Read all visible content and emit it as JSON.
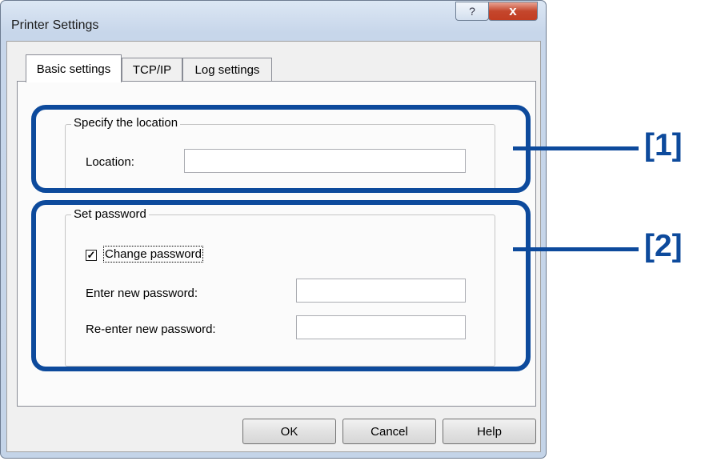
{
  "window": {
    "title": "Printer Settings",
    "help_glyph": "?",
    "close_glyph": "x"
  },
  "tabs": [
    {
      "label": "Basic settings",
      "active": true
    },
    {
      "label": "TCP/IP",
      "active": false
    },
    {
      "label": "Log settings",
      "active": false
    }
  ],
  "location_group": {
    "title": "Specify the location",
    "label": "Location:",
    "value": ""
  },
  "password_group": {
    "title": "Set password",
    "change_checkbox_label": "Change password",
    "change_checked": true,
    "check_glyph": "✓",
    "new_label": "Enter new password:",
    "new_value": "",
    "reenter_label": "Re-enter new password:",
    "reenter_value": ""
  },
  "buttons": {
    "ok": "OK",
    "cancel": "Cancel",
    "help": "Help"
  },
  "callouts": {
    "one": "[1]",
    "two": "[2]"
  },
  "colors": {
    "callout": "#0d4a9c",
    "close_button": "#c4462c"
  }
}
